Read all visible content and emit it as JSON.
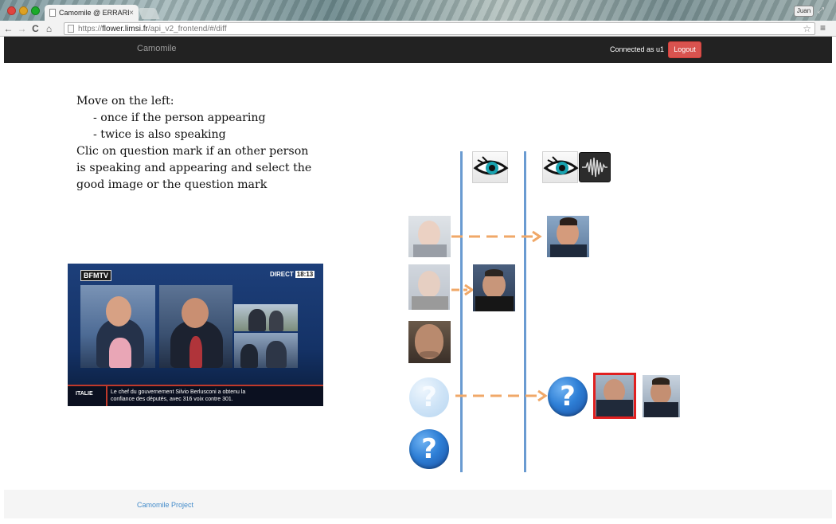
{
  "browser": {
    "tab_title": "Camomile @ ERRARE",
    "tab_close": "×",
    "user_chip": "Juan",
    "url_scheme": "https://",
    "url_host": "flower.limsi.fr",
    "url_path": "/api_v2_frontend/#/diff",
    "icons": {
      "back": "←",
      "forward": "→",
      "reload": "C",
      "home": "⌂",
      "star": "☆",
      "menu": "≡",
      "fullscreen": "⤢"
    }
  },
  "navbar": {
    "brand": "Camomile",
    "connected_text": "Connected as u1",
    "logout_label": "Logout",
    "logout_color": "#d9534f"
  },
  "instructions": {
    "line1": "Move on the left:",
    "line2": "- once if the person appearing",
    "line3": "- twice is also speaking",
    "line4": "Clic on question mark if an other person",
    "line5": "is speaking and appearing and select the",
    "line6": "good image or the question mark"
  },
  "video": {
    "channel_logo": "BFMTV",
    "live_label": "DIRECT",
    "clock": "18:13",
    "ticker_tag": "ITALIE",
    "ticker_line1": "Le chef du gouvernement Silvio Berlusconi a obtenu la",
    "ticker_line2": "confiance des députés, avec 316 voix contre 301."
  },
  "diagram": {
    "line_color": "#6a9bd1",
    "arrow_color": "#f0a868",
    "selection_color": "#e02020",
    "question_mark": "?",
    "columns": [
      "eye-icon",
      "eye-icon + waveform-icon"
    ]
  },
  "footer": {
    "link_label": "Camomile Project"
  }
}
